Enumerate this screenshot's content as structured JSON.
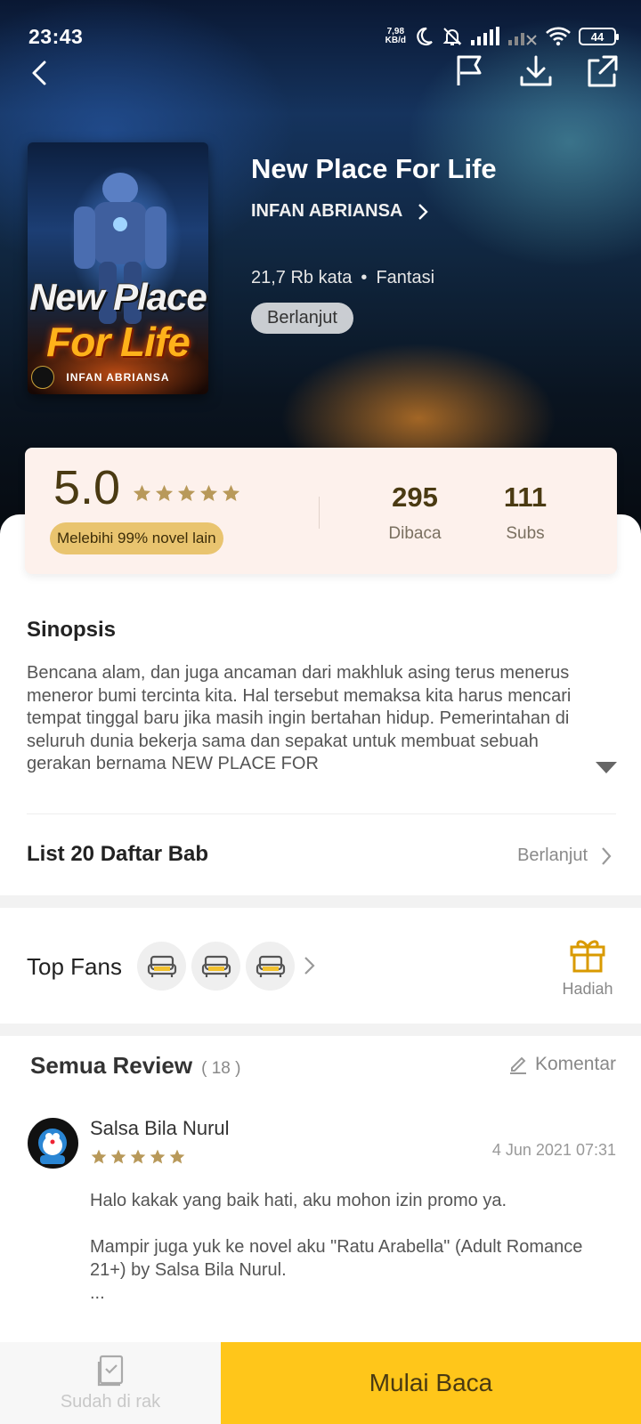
{
  "status_bar": {
    "time": "23:43",
    "net_speed_value": "7,98",
    "net_speed_unit": "KB/d",
    "battery": "44"
  },
  "book": {
    "title": "New Place For Life",
    "author": "INFAN ABRIANSA",
    "words": "21,7 Rb kata",
    "genre": "Fantasi",
    "status": "Berlanjut",
    "cover_title_line1": "New Place",
    "cover_title_line2": "For Life",
    "cover_author": "INFAN ABRIANSA"
  },
  "rating": {
    "score": "5.0",
    "stars": 5,
    "compare": "Melebihi 99% novel lain",
    "reads_value": "295",
    "reads_label": "Dibaca",
    "subs_value": "111",
    "subs_label": "Subs"
  },
  "synopsis": {
    "title": "Sinopsis",
    "text": "Bencana alam, dan juga ancaman dari makhluk asing terus menerus meneror bumi tercinta kita. Hal tersebut memaksa kita harus mencari tempat tinggal baru jika masih ingin bertahan hidup. Pemerintahan di seluruh dunia bekerja sama dan sepakat untuk membuat sebuah gerakan bernama NEW PLACE FOR"
  },
  "chapters": {
    "title": "List 20 Daftar Bab",
    "status": "Berlanjut"
  },
  "top_fans": {
    "title": "Top Fans",
    "gift_label": "Hadiah"
  },
  "reviews": {
    "title": "Semua Review",
    "count": "( 18 )",
    "comment_label": "Komentar",
    "items": [
      {
        "name": "Salsa Bila Nurul",
        "stars": 5,
        "date": "4 Jun 2021 07:31",
        "text": "Halo kakak yang baik hati, aku mohon izin promo ya.\n\nMampir juga yuk ke novel aku \"Ratu Arabella\" (Adult Romance 21+) by Salsa Bila Nurul.\n..."
      }
    ]
  },
  "bottom_bar": {
    "shelf_label": "Sudah di rak",
    "read_label": "Mulai Baca"
  },
  "colors": {
    "accent": "#ffc61a",
    "star": "#b8995a",
    "rating_bg": "#fdf1ec"
  }
}
